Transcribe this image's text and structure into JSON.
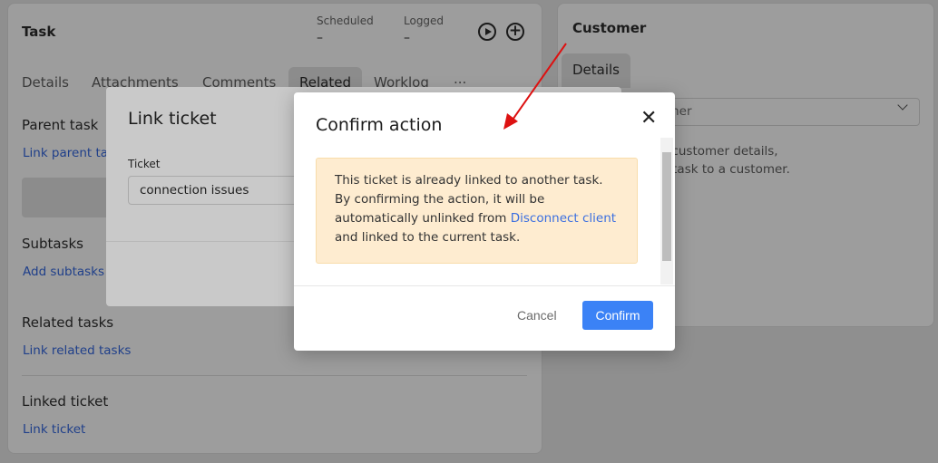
{
  "task": {
    "title": "Task",
    "scheduled_label": "Scheduled",
    "scheduled_value": "–",
    "logged_label": "Logged",
    "logged_value": "–",
    "tabs": [
      "Details",
      "Attachments",
      "Comments",
      "Related",
      "Worklog",
      "..."
    ],
    "active_tab": "Related",
    "sections": [
      {
        "title": "Parent task",
        "link": "Link parent task"
      },
      {
        "title": "Subtasks",
        "link": "Add subtasks"
      },
      {
        "title": "Related tasks",
        "link": "Link related tasks"
      },
      {
        "title": "Linked ticket",
        "link": "Link ticket"
      }
    ]
  },
  "customer": {
    "title": "Customer",
    "tab": "Details",
    "select_placeholder": "Select customer",
    "hint_line1": "To see customer details,",
    "hint_line2": "please link the task to a customer."
  },
  "link_modal": {
    "title": "Link ticket",
    "ticket_label": "Ticket",
    "ticket_value": "connection issues"
  },
  "confirm_modal": {
    "title": "Confirm action",
    "message_pre": "This ticket is already linked to another task. By confirming the action, it will be automatically unlinked from ",
    "message_link": "Disconnect client",
    "message_post": " and linked to the current task.",
    "cancel": "Cancel",
    "confirm": "Confirm"
  },
  "colors": {
    "primary": "#3b82f6",
    "alert_bg": "#feecd0",
    "annotation_arrow": "#dd1111"
  }
}
